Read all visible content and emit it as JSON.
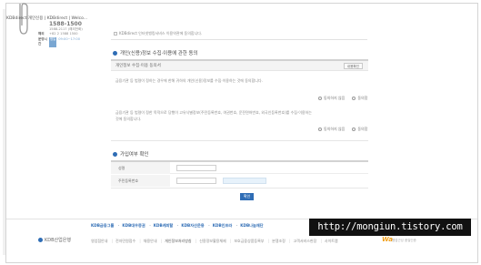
{
  "tabbar": {
    "label": "KDBdirect 개인신용 | KDBdirect | Welco..."
  },
  "side": {
    "rows": [
      {
        "label": "",
        "value": "1588-1500"
      },
      {
        "label": "",
        "value": "1588-2117 (해외전화)"
      },
      {
        "label": "해외",
        "value": "+82 2 1588 1500"
      },
      {
        "label": "운영시간",
        "badge": "평일",
        "value": "09:00~17:00"
      }
    ]
  },
  "top_note": "KDBdirect 인터넷뱅킹서비스 이용약관에 동의합니다.",
  "section1": {
    "title": "개인(신용)정보 수집·이용에 관한 동의",
    "head": "개인정보 수집·이용 동의서",
    "detail_button": "내용확인",
    "para1": "금융기관 등 법령이 정하는 경우에 한해 귀하의 개인(신용)정보를 수집·이용하는 것에 동의합니다.",
    "para2a": "금융기관 등 법령이 정한 목적으로 당행이 고유식별정보(주민등록번호, 여권번호, 운전면허번호, 외국인등록번호)를 수집·이용하는",
    "para2b": "것에 동의합니다.",
    "radio_disagree": "동의하지 않음",
    "radio_agree": "동의함"
  },
  "section2": {
    "title": "가입여부 확인",
    "name_label": "성명",
    "rrn_label": "주민등록번호",
    "confirm_button": "확인"
  },
  "footer": {
    "family": [
      "KDB금융그룹",
      "KDB대우증권",
      "KDB캐피탈",
      "KDB자산운용",
      "KDB인프라",
      "KDB나눔재단"
    ],
    "logo": "KDB산업은행",
    "links": [
      "영업점안내",
      "전자민원접수",
      "채용안내",
      "개인정보처리방침",
      "신용정보활용체제",
      "보호금융상품등록부",
      "분쟁조정",
      "고객서비스헌장",
      "사이트맵"
    ],
    "wa_mark": "Wa",
    "wa_sub": "웹접근성 품질인증"
  },
  "watermark": "http://mongiun.tistory.com",
  "colors": {
    "accent": "#2f6db5",
    "watermark_bg": "#111111"
  }
}
